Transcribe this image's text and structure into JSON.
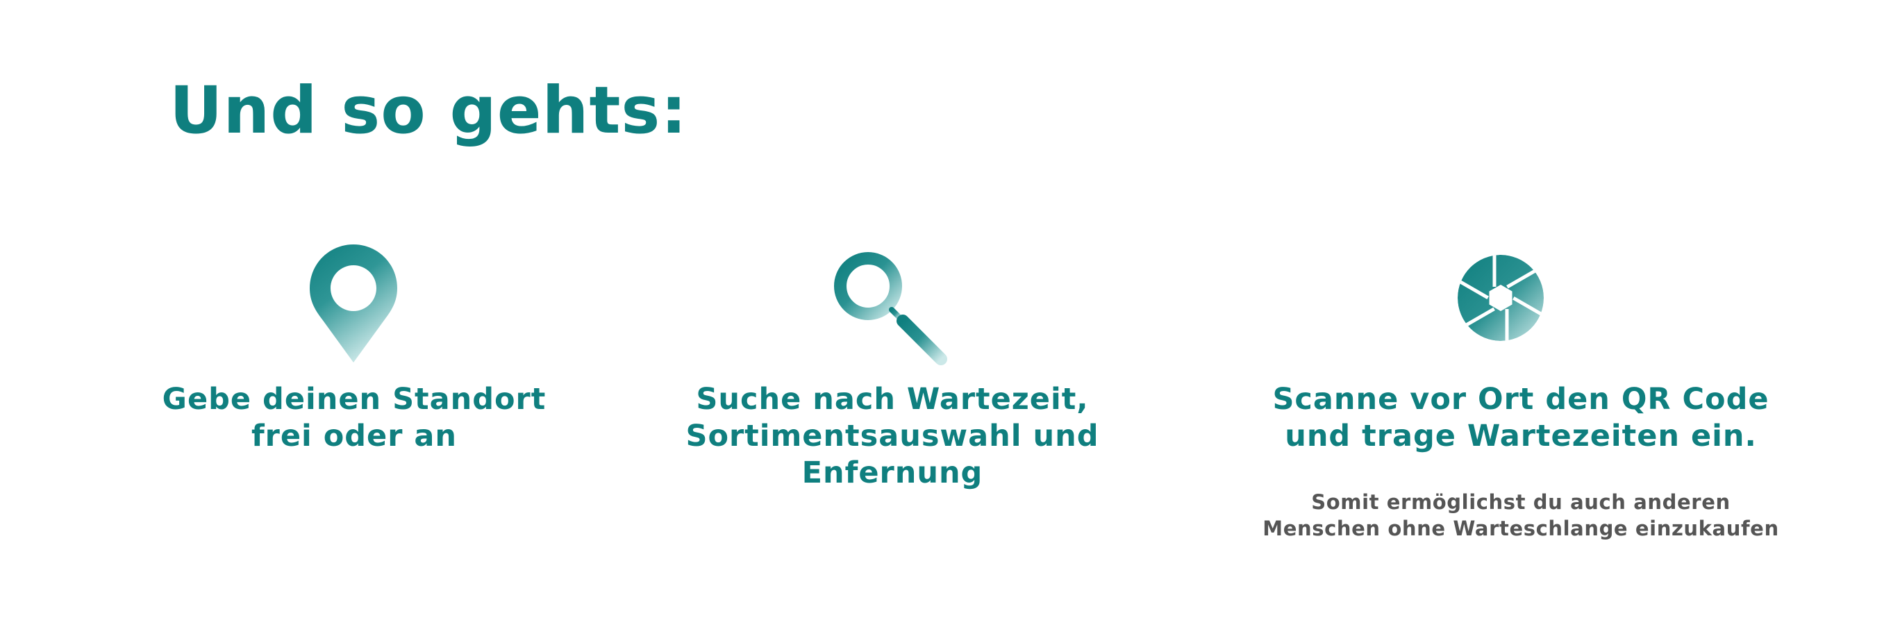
{
  "heading": "Und so gehts:",
  "colors": {
    "accent": "#0f7f7f",
    "accent_light": "#bfe3e3",
    "note_text": "#555555",
    "background": "#ffffff"
  },
  "steps": [
    {
      "icon": "map-pin-icon",
      "text": "Gebe deinen Standort\nfrei oder an"
    },
    {
      "icon": "magnifier-icon",
      "text": "Suche nach Wartezeit,\nSortimentsauswahl und\nEnfernung"
    },
    {
      "icon": "camera-shutter-icon",
      "text": "Scanne vor Ort den QR Code\nund trage Wartezeiten ein.",
      "note": "Somit ermöglichst du auch anderen\nMenschen ohne Warteschlange einzukaufen"
    }
  ]
}
